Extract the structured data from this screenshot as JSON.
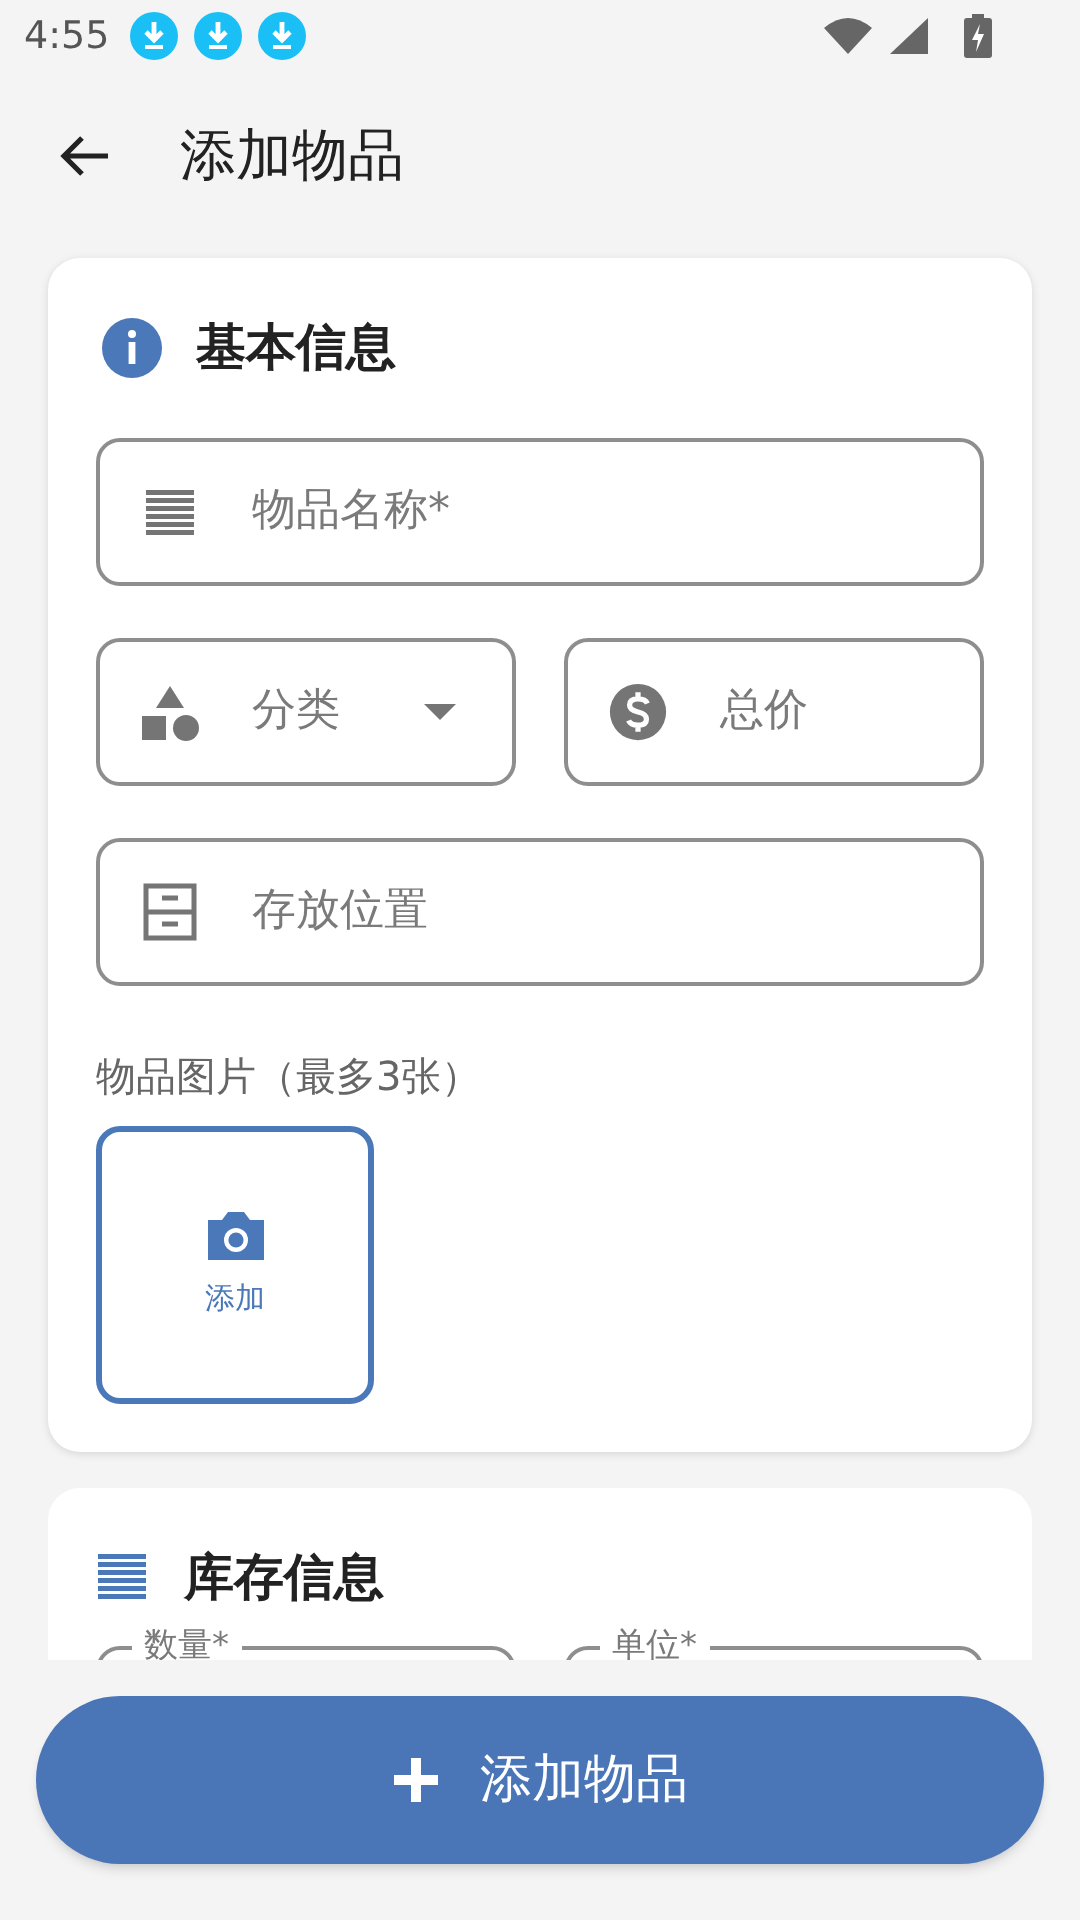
{
  "status_bar": {
    "time": "4:55"
  },
  "app_bar": {
    "title": "添加物品"
  },
  "basic_info": {
    "title": "基本信息",
    "rows": [
      [
        {
          "kind": "name",
          "placeholder": "物品名称*"
        }
      ],
      [
        {
          "kind": "category",
          "placeholder": "分类"
        },
        {
          "kind": "price",
          "placeholder": "总价"
        }
      ],
      [
        {
          "kind": "location",
          "placeholder": "存放位置"
        }
      ]
    ],
    "photos": {
      "label": "物品图片（最多3张）",
      "add_label": "添加"
    }
  },
  "stock_info": {
    "title": "库存信息",
    "fields": [
      {
        "label": "数量*"
      },
      {
        "label": "单位*"
      }
    ]
  },
  "submit_button": {
    "label": "添加物品"
  }
}
